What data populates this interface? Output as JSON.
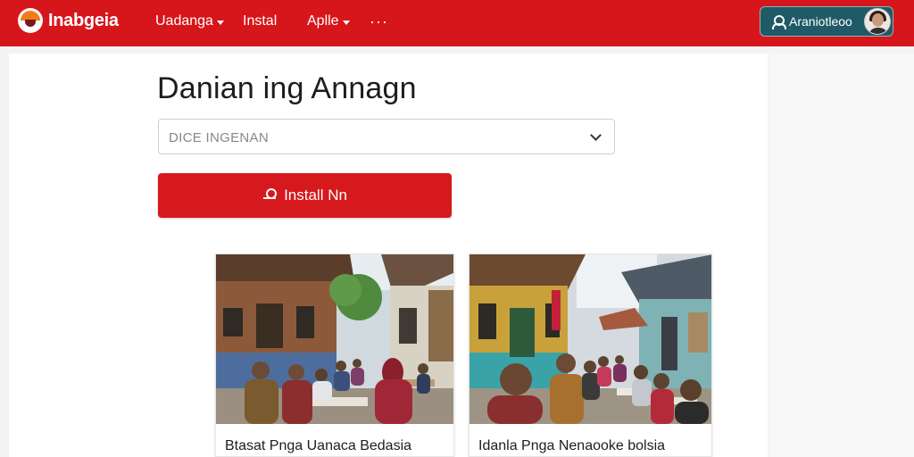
{
  "header": {
    "logo_text": "Inabgeia",
    "nav": [
      {
        "label": "Uadanga",
        "dropdown": true
      },
      {
        "label": "Instal",
        "dropdown": false
      },
      {
        "label": "Aplle",
        "dropdown": true
      }
    ],
    "more_label": "···",
    "user_name": "Araniotleoo",
    "brand_color": "#d6161b"
  },
  "main": {
    "title": "Danian ing Annagn",
    "select_value": "DICE INGENAN",
    "install_button_label": "Install Nn"
  },
  "cards": [
    {
      "caption": "Btasat Pnga Uanaca Bedasia",
      "image": "village-market-scene-1"
    },
    {
      "caption": "Idanla Pnga Nenaooke bolsia",
      "image": "village-market-scene-2"
    }
  ],
  "colors": {
    "primary": "#d6191d",
    "user_pill": "#1f5a66"
  }
}
